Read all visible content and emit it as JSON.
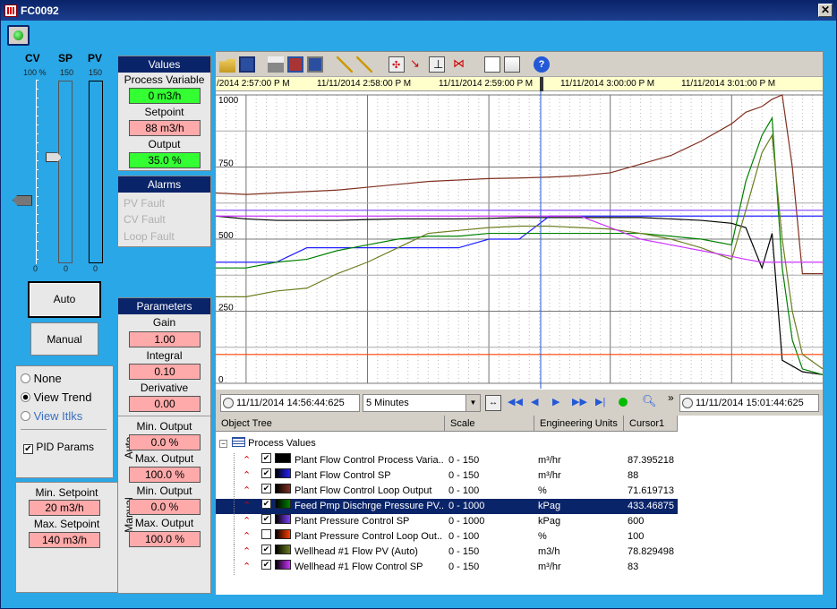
{
  "window": {
    "title": "FC0092",
    "close_label": "✕"
  },
  "bars": {
    "headers": [
      "CV",
      "SP",
      "PV"
    ],
    "cv_top": "100 %",
    "sp_top": "150",
    "pv_top": "150",
    "cv_bottom": "0",
    "sp_bottom": "0",
    "pv_bottom": "0",
    "sp_fraction": 0.587,
    "cv_fraction": 0.35
  },
  "mode_buttons": {
    "auto": "Auto",
    "manual": "Manual"
  },
  "view_options": {
    "none": "None",
    "trend": "View Trend",
    "itlks": "View Itlks",
    "pid": "PID Params",
    "selected": "trend",
    "pid_checked": true
  },
  "setpoint_limits": {
    "min_label": "Min. Setpoint",
    "min_value": "20 m3/h",
    "max_label": "Max. Setpoint",
    "max_value": "140 m3/h"
  },
  "values": {
    "header": "Values",
    "pv_label": "Process Variable",
    "pv_value": "0 m3/h",
    "sp_label": "Setpoint",
    "sp_value": "88 m3/h",
    "out_label": "Output",
    "out_value": "35.0 %"
  },
  "alarms": {
    "header": "Alarms",
    "items": [
      "PV Fault",
      "CV Fault",
      "Loop Fault"
    ]
  },
  "parameters": {
    "header": "Parameters",
    "gain_label": "Gain",
    "gain_value": "1.00",
    "integral_label": "Integral",
    "integral_value": "0.10",
    "derivative_label": "Derivative",
    "derivative_value": "0.00",
    "auto_label": "Auto",
    "manual_label": "Manual",
    "min_out_label": "Min. Output",
    "max_out_label": "Max. Output",
    "auto_min": "0.0 %",
    "auto_max": "100.0 %",
    "man_min": "0.0 %",
    "man_max": "100.0 %"
  },
  "chart": {
    "time_labels": [
      "/2014 2:57:00 P M",
      "11/11/2014 2:58:00 P M",
      "11/11/2014 2:59:00 P M",
      "11/11/2014 3:00:00 P M",
      "11/11/2014 3:01:00 P M"
    ],
    "y_ticks": [
      "1000",
      "750",
      "500",
      "250",
      "0"
    ],
    "start_time": "11/11/2014 14:56:44:625",
    "end_time": "11/11/2014 15:01:44:625",
    "span": "5 Minutes",
    "more": "»"
  },
  "chart_data": {
    "type": "line",
    "title": "",
    "xlabel": "",
    "ylabel": "",
    "x_range": [
      "11/11/2014 2:56:44 PM",
      "11/11/2014 3:01:44 PM"
    ],
    "ylim": [
      0,
      1000
    ],
    "grid": true,
    "x": [
      0,
      15,
      30,
      45,
      60,
      75,
      90,
      105,
      120,
      135,
      150,
      165,
      180,
      195,
      210,
      225,
      240,
      255,
      262,
      270,
      275,
      280,
      285,
      290,
      300
    ],
    "series": [
      {
        "name": "Plant Flow Control Process Variable",
        "color": "#000000",
        "values": [
          580,
          570,
          565,
          565,
          565,
          568,
          570,
          570,
          570,
          572,
          575,
          575,
          575,
          575,
          575,
          570,
          565,
          555,
          540,
          400,
          520,
          80,
          60,
          40,
          30
        ]
      },
      {
        "name": "Plant Flow Control SP",
        "color": "#2020ff",
        "values": [
          420,
          420,
          420,
          470,
          470,
          470,
          470,
          470,
          470,
          500,
          500,
          580,
          580,
          580,
          580,
          580,
          580,
          580,
          580,
          580,
          580,
          580,
          580,
          580,
          580
        ]
      },
      {
        "name": "Plant Flow Control Loop Output",
        "color": "#803020",
        "values": [
          660,
          655,
          660,
          665,
          670,
          680,
          690,
          700,
          705,
          710,
          712,
          715,
          720,
          730,
          760,
          790,
          840,
          900,
          940,
          960,
          985,
          1000,
          750,
          380,
          380
        ]
      },
      {
        "name": "Feed Pmp Dischrge Pressure PV",
        "color": "#008000",
        "values": [
          400,
          400,
          420,
          430,
          460,
          480,
          500,
          510,
          510,
          520,
          520,
          520,
          520,
          520,
          520,
          510,
          500,
          480,
          700,
          860,
          920,
          400,
          150,
          50,
          30
        ]
      },
      {
        "name": "Plant Pressure Control SP",
        "color": "#8040ff",
        "values": [
          600,
          600,
          600,
          600,
          600,
          600,
          600,
          600,
          600,
          600,
          600,
          600,
          600,
          600,
          600,
          600,
          600,
          600,
          600,
          600,
          600,
          600,
          600,
          600,
          600
        ]
      },
      {
        "name": "Plant Pressure Control Loop Output",
        "color": "#ff4000",
        "values": [
          100,
          100,
          100,
          100,
          100,
          100,
          100,
          100,
          100,
          100,
          100,
          100,
          100,
          100,
          100,
          100,
          100,
          100,
          100,
          100,
          100,
          100,
          100,
          100,
          100
        ]
      },
      {
        "name": "Wellhead #1 Flow PV (Auto)",
        "color": "#6b7f20",
        "values": [
          300,
          300,
          320,
          330,
          380,
          420,
          470,
          520,
          530,
          540,
          545,
          545,
          540,
          535,
          520,
          500,
          470,
          430,
          600,
          800,
          860,
          500,
          250,
          100,
          50
        ]
      },
      {
        "name": "Wellhead #1 Flow Control SP",
        "color": "#cc33ff",
        "values": [
          580,
          580,
          580,
          580,
          580,
          580,
          580,
          580,
          580,
          580,
          580,
          580,
          580,
          540,
          500,
          480,
          460,
          440,
          430,
          420,
          420,
          420,
          420,
          420,
          420
        ]
      }
    ]
  },
  "grid_table": {
    "headers": [
      "Object Tree",
      "Scale",
      "Engineering Units",
      "Cursor1"
    ],
    "root": "Process Values",
    "rows": [
      {
        "name": "Plant Flow Control Process Varia...",
        "scale": "0 - 150",
        "units": "m³/hr",
        "cursor": "87.395218",
        "color": "#000000",
        "checked": true
      },
      {
        "name": "Plant Flow Control SP",
        "scale": "0 - 150",
        "units": "m³/hr",
        "cursor": "88",
        "color": "#2020ff",
        "checked": true
      },
      {
        "name": "Plant Flow Control Loop Output",
        "scale": "0 - 100",
        "units": "%",
        "cursor": "71.619713",
        "color": "#803020",
        "checked": true
      },
      {
        "name": "Feed Pmp Dischrge Pressure PV...",
        "scale": "0 - 1000",
        "units": "kPag",
        "cursor": "433.46875",
        "color": "#008000",
        "checked": true
      },
      {
        "name": "Plant Pressure Control SP",
        "scale": "0 - 1000",
        "units": "kPag",
        "cursor": "600",
        "color": "#8040ff",
        "checked": true
      },
      {
        "name": "Plant Pressure Control Loop Out...",
        "scale": "0 - 100",
        "units": "%",
        "cursor": "100",
        "color": "#ff4000",
        "checked": false
      },
      {
        "name": "Wellhead #1 Flow PV (Auto)",
        "scale": "0 - 150",
        "units": "m3/h",
        "cursor": "78.829498",
        "color": "#6b7f20",
        "checked": true
      },
      {
        "name": "Wellhead #1 Flow Control SP",
        "scale": "0 - 150",
        "units": "m³/hr",
        "cursor": "83",
        "color": "#cc33ff",
        "checked": true
      }
    ],
    "selected_index": 3
  }
}
